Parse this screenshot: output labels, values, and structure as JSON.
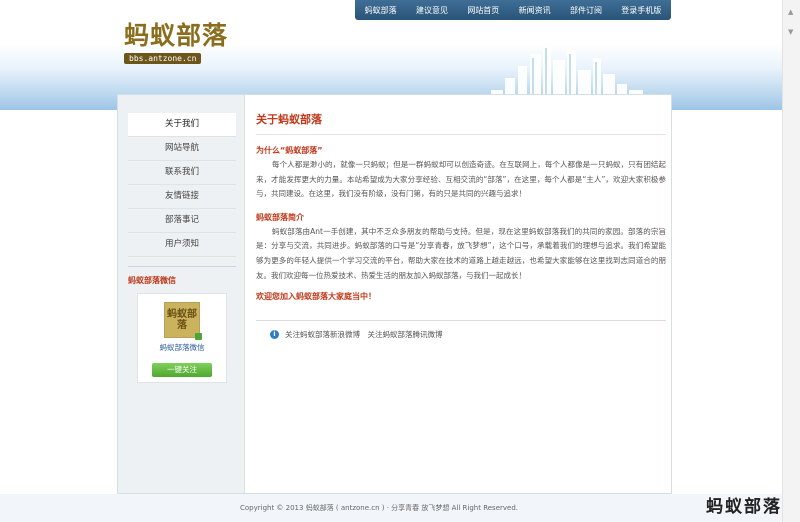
{
  "nav": [
    "蚂蚁部落",
    "建议意见",
    "网站首页",
    "新闻资讯",
    "部件订阅",
    "登录手机版"
  ],
  "logo": {
    "cn": "蚂蚁部落",
    "url": "bbs.antzone.cn"
  },
  "sidebar": {
    "items": [
      {
        "label": "关于我们",
        "active": true
      },
      {
        "label": "网站导航",
        "active": false
      },
      {
        "label": "联系我们",
        "active": false
      },
      {
        "label": "友情链接",
        "active": false
      },
      {
        "label": "部落事记",
        "active": false
      },
      {
        "label": "用户须知",
        "active": false
      }
    ],
    "tribe_heading": "蚂蚁部落微信",
    "qr_text": "蚂蚁部落",
    "card_name": "蚂蚁部落微信",
    "follow_label": "一键关注"
  },
  "main": {
    "title": "关于蚂蚁部落",
    "sections": [
      {
        "heading": "为什么“蚂蚁部落”",
        "body": "每个人都是渺小的，就像一只蚂蚁；但是一群蚂蚁却可以创造奇迹。在互联网上，每个人都像是一只蚂蚁，只有团结起来，才能发挥更大的力量。本站希望成为大家分享经验、互相交流的“部落”，在这里，每个人都是“主人”，欢迎大家积极参与，共同建设。在这里，我们没有阶级，没有门第，有的只是共同的兴趣与追求！"
      },
      {
        "heading": "蚂蚁部落简介",
        "body": "蚂蚁部落由Ant一手创建，其中不乏众多朋友的帮助与支持。但是，现在这里蚂蚁部落我们的共同的家园。部落的宗旨是：分享与交流，共同进步。蚂蚁部落的口号是“分享青春，放飞梦想”，这个口号，承载着我们的理想与追求。我们希望能够为更多的年轻人提供一个学习交流的平台，帮助大家在技术的道路上越走越远，也希望大家能够在这里找到志同道合的朋友。我们欢迎每一位热爱技术、热爱生活的朋友加入蚂蚁部落，与我们一起成长！"
      }
    ],
    "welcome": "欢迎您加入蚂蚁部落大家庭当中！",
    "bottom_note": "关注蚂蚁部落新浪微博　关注蚂蚁部落腾讯微博"
  },
  "footer": {
    "copyright": "Copyright © 2013 蚂蚁部落 ( antzone.cn ) · 分享青春 放飞梦想 All Right Reserved."
  },
  "watermark": "蚂蚁部落",
  "colors": {
    "accent_red": "#c0391b",
    "nav_blue": "#2a5479",
    "follow_green": "#4da830"
  }
}
